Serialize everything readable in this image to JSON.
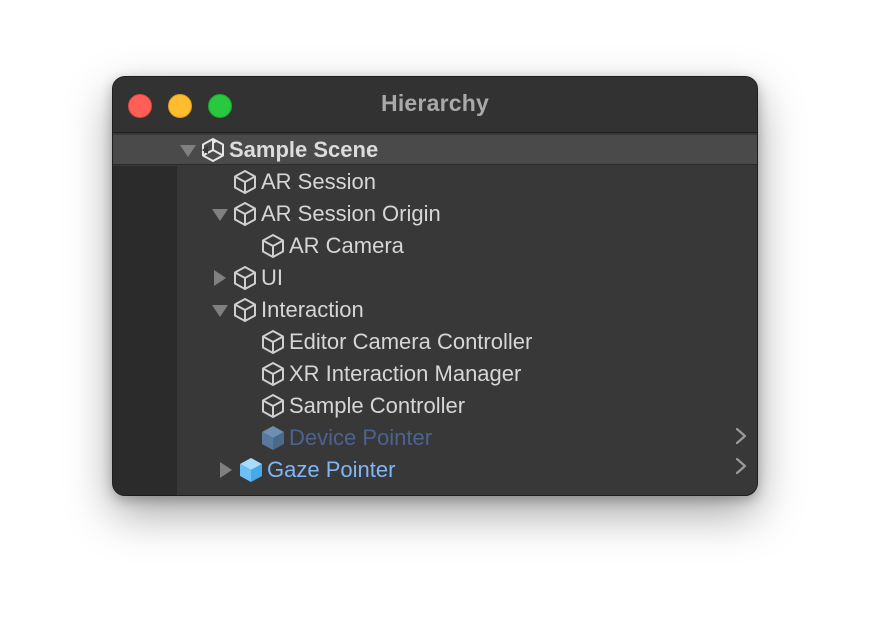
{
  "window": {
    "title": "Hierarchy"
  },
  "colors": {
    "close": "#ff5f57",
    "minimize": "#febc2e",
    "maximize": "#28c840",
    "window_bg": "#383838",
    "prefab_dim": "#4a6391",
    "prefab": "#7fb6f5"
  },
  "scene": {
    "label": "Sample Scene",
    "icon": "unity-logo-icon",
    "expanded": true
  },
  "items": [
    {
      "label": "AR Session",
      "icon": "cube-icon",
      "depth": 1,
      "expander": "none"
    },
    {
      "label": "AR Session Origin",
      "icon": "cube-icon",
      "depth": 1,
      "expander": "expanded"
    },
    {
      "label": "AR Camera",
      "icon": "cube-icon",
      "depth": 2,
      "expander": "none"
    },
    {
      "label": "UI",
      "icon": "cube-icon",
      "depth": 1,
      "expander": "collapsed"
    },
    {
      "label": "Interaction",
      "icon": "cube-icon",
      "depth": 1,
      "expander": "expanded"
    },
    {
      "label": "Editor Camera Controller",
      "icon": "cube-icon",
      "depth": 2,
      "expander": "none"
    },
    {
      "label": "XR Interaction Manager",
      "icon": "cube-icon",
      "depth": 2,
      "expander": "none"
    },
    {
      "label": "Sample Controller",
      "icon": "cube-icon",
      "depth": 2,
      "expander": "none"
    },
    {
      "label": "Device Pointer",
      "icon": "prefab-cube-icon",
      "depth": 2,
      "expander": "none",
      "state": "prefab-inactive"
    },
    {
      "label": "Gaze Pointer",
      "icon": "prefab-cube-icon",
      "depth": 2,
      "expander": "collapsed",
      "state": "prefab"
    }
  ]
}
